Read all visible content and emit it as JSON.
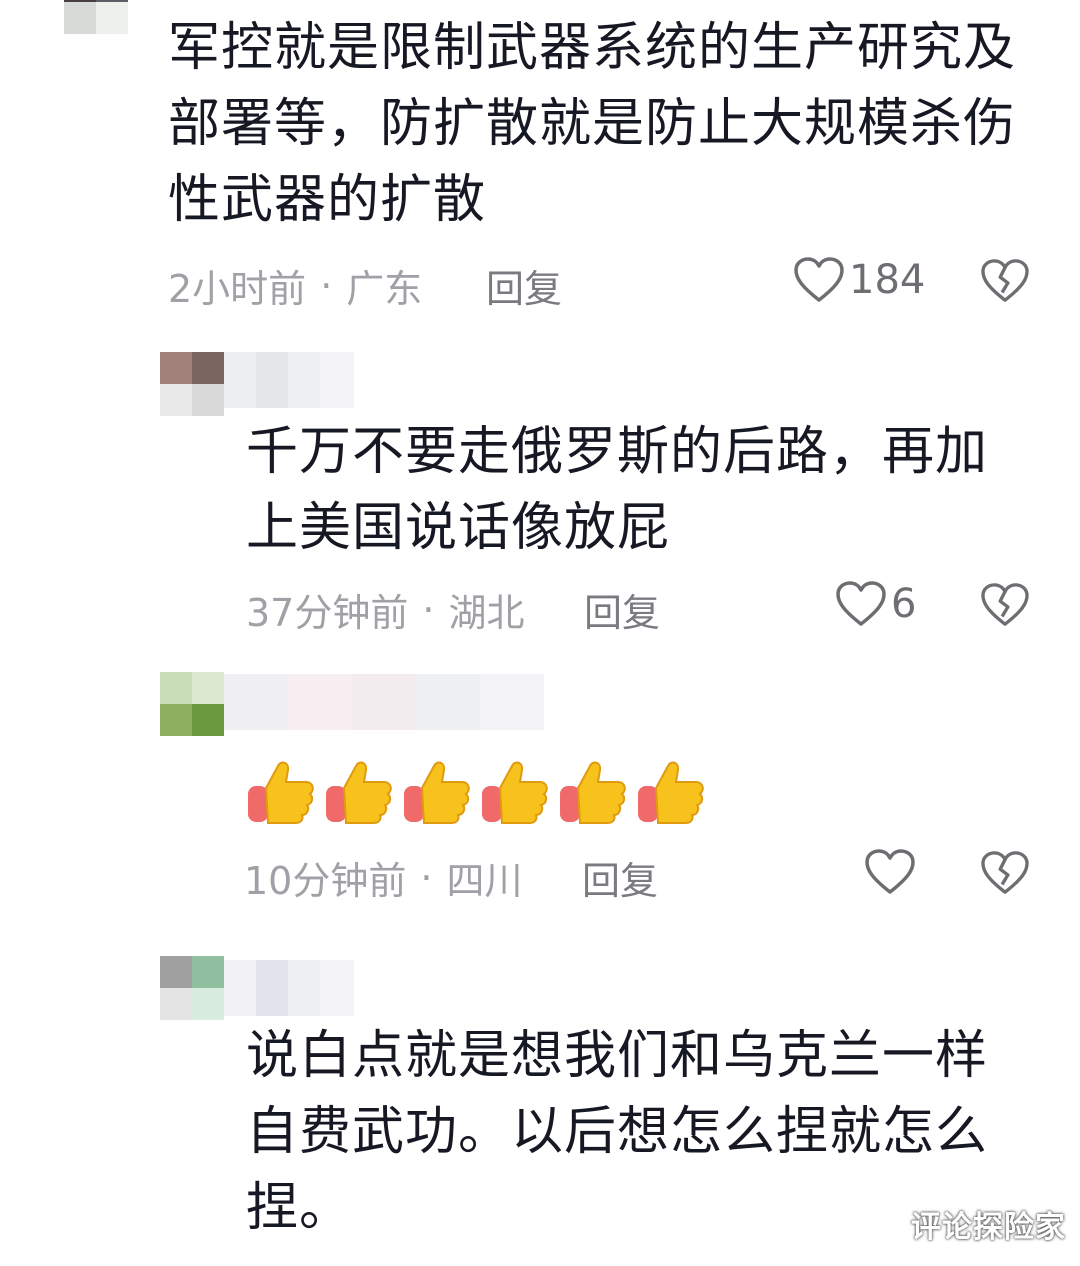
{
  "comments": [
    {
      "text": "军控就是限制武器系统的生产研究及\n部署等，防扩散就是防止大规模杀伤\n性武器的扩散",
      "time": "2小时前",
      "location": "广东",
      "reply_label": "回复",
      "like_count": "184"
    },
    {
      "text": "千万不要走俄罗斯的后路，再加\n上美国说话像放屁",
      "time": "37分钟前",
      "location": "湖北",
      "reply_label": "回复",
      "like_count": "6"
    },
    {
      "emoji": [
        "thumbs-up",
        "thumbs-up",
        "thumbs-up",
        "thumbs-up",
        "thumbs-up",
        "thumbs-up"
      ],
      "time": "10分钟前",
      "location": "四川",
      "reply_label": "回复",
      "like_count": ""
    },
    {
      "text": "说白点就是想我们和乌克兰一样\n自费武功。以后想怎么捏就怎么\n捏。"
    }
  ],
  "separator": "·",
  "watermark": "评论探险家",
  "icons": {
    "like": "heart-outline-icon",
    "dislike": "broken-heart-icon",
    "emoji": "thumbs-up-emoji"
  },
  "colors": {
    "text": "#161823",
    "meta": "#a0a0a6",
    "icon": "#6d6d72"
  }
}
